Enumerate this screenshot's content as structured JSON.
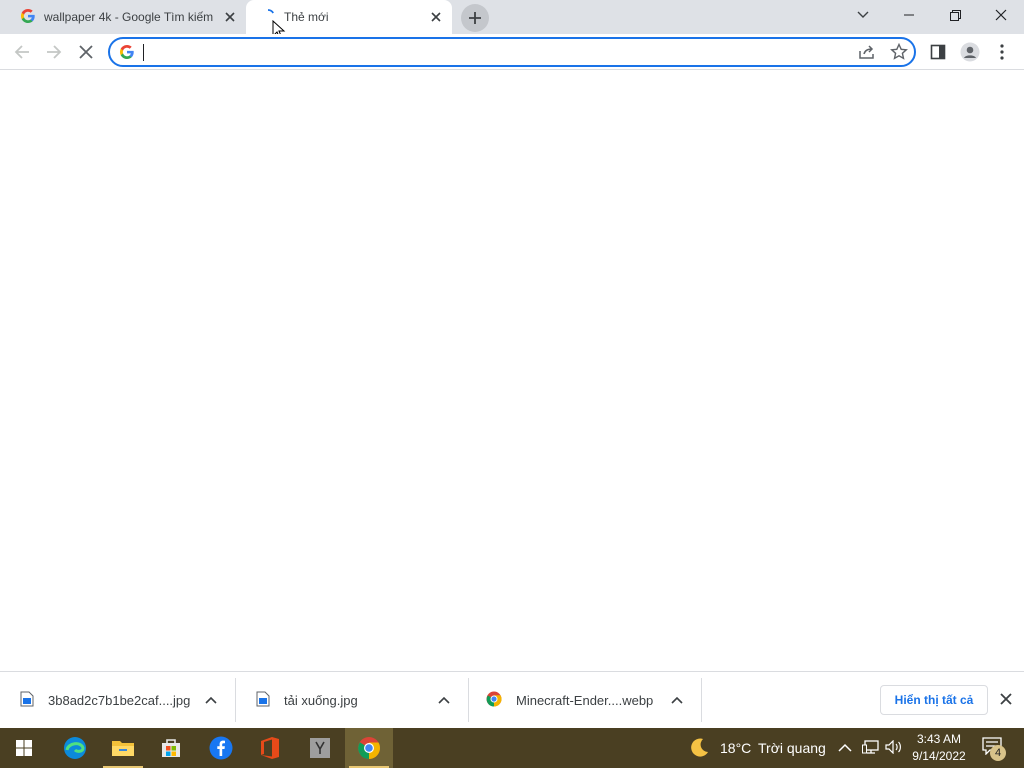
{
  "tabs": [
    {
      "title": "wallpaper 4k - Google Tìm kiếm",
      "active": false
    },
    {
      "title": "Thẻ mới",
      "active": true
    }
  ],
  "window": {
    "accent": "#1a73e8"
  },
  "omnibox": {
    "value": "",
    "placeholder": ""
  },
  "downloads": {
    "items": [
      {
        "name": "3b8ad2c7b1be2caf....jpg",
        "icon": "image-file-icon"
      },
      {
        "name": "tải xuống.jpg",
        "icon": "image-file-icon"
      },
      {
        "name": "Minecraft-Ender....webp",
        "icon": "chrome-icon"
      }
    ],
    "show_all": "Hiển thị tất cả"
  },
  "taskbar": {
    "apps": [
      "windows-start-icon",
      "edge-icon",
      "file-explorer-icon",
      "microsoft-store-icon",
      "facebook-icon",
      "office-icon",
      "yandex-icon",
      "chrome-icon"
    ],
    "weather": {
      "temp": "18°C",
      "condition": "Trời quang"
    },
    "clock": {
      "time": "3:43 AM",
      "date": "9/14/2022"
    },
    "notification_count": "4"
  }
}
